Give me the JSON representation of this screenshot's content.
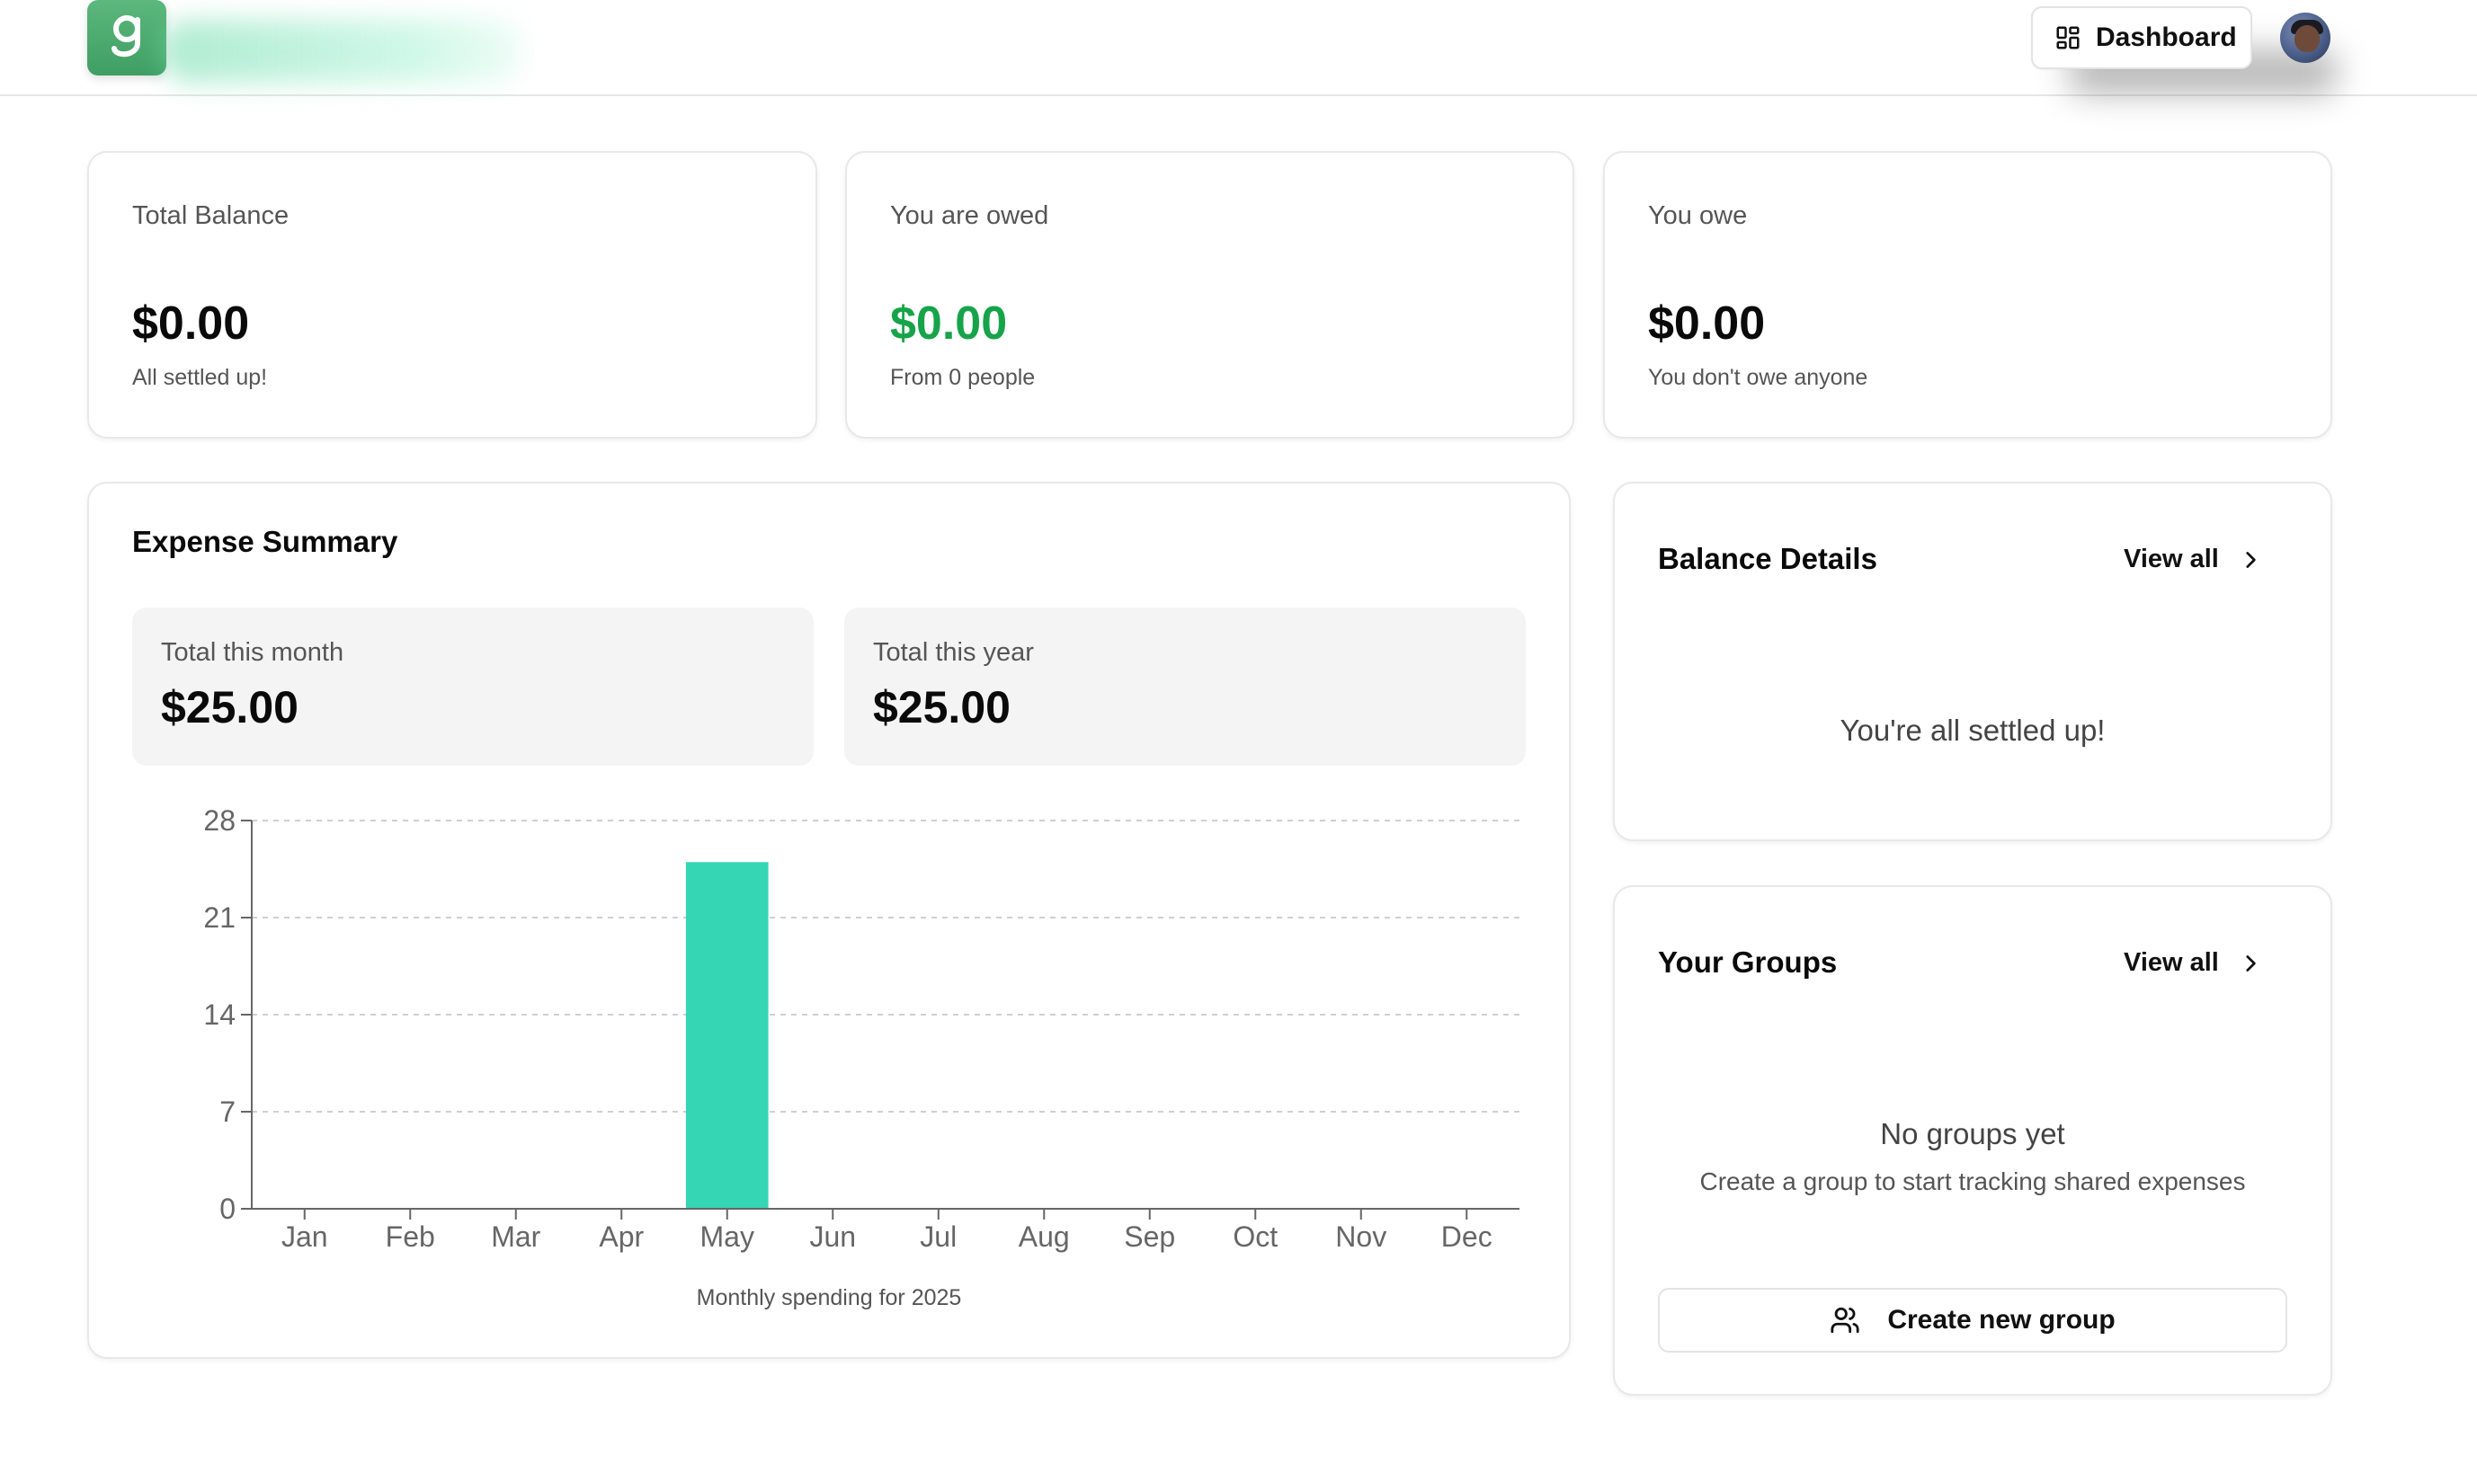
{
  "header": {
    "dashboard_label": "Dashboard",
    "brand_color": "#4caf72"
  },
  "stats": [
    {
      "label": "Total Balance",
      "value": "$0.00",
      "note": "All settled up!",
      "color": "#0a0a0a"
    },
    {
      "label": "You are owed",
      "value": "$0.00",
      "note": "From 0 people",
      "color": "#17a34a"
    },
    {
      "label": "You owe",
      "value": "$0.00",
      "note": "You don't owe anyone",
      "color": "#0a0a0a"
    }
  ],
  "expense_summary": {
    "title": "Expense Summary",
    "month_label": "Total this month",
    "month_value": "$25.00",
    "year_label": "Total this year",
    "year_value": "$25.00",
    "caption": "Monthly spending for 2025"
  },
  "chart_data": {
    "type": "bar",
    "categories": [
      "Jan",
      "Feb",
      "Mar",
      "Apr",
      "May",
      "Jun",
      "Jul",
      "Aug",
      "Sep",
      "Oct",
      "Nov",
      "Dec"
    ],
    "values": [
      0,
      0,
      0,
      0,
      25,
      0,
      0,
      0,
      0,
      0,
      0,
      0
    ],
    "title": "",
    "xlabel": "",
    "ylabel": "",
    "ylim": [
      0,
      28
    ],
    "yticks": [
      0,
      7,
      14,
      21,
      28
    ],
    "grid": true,
    "bar_color": "#34d6b4",
    "caption": "Monthly spending for 2025"
  },
  "balance_details": {
    "title": "Balance Details",
    "view_all": "View all",
    "empty": "You're all settled up!"
  },
  "groups": {
    "title": "Your Groups",
    "view_all": "View all",
    "empty_title": "No groups yet",
    "empty_sub": "Create a group to start tracking shared expenses",
    "create_label": "Create new group"
  }
}
